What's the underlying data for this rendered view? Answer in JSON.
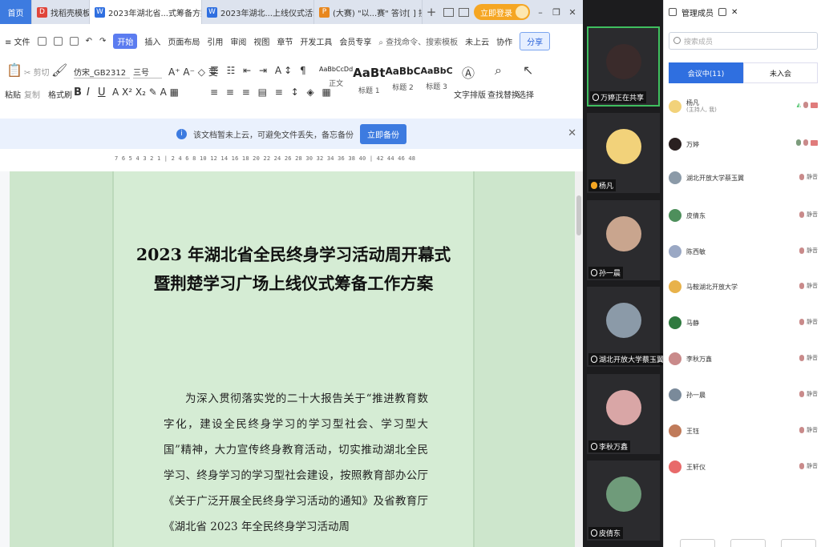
{
  "tabs": [
    {
      "label": "首页",
      "kind": "home"
    },
    {
      "label": "找稻壳模板",
      "icon_color": "#e0453a",
      "icon_char": "D"
    },
    {
      "label": "2023年湖北省...式筹备方案8.9",
      "icon_color": "#2f6fe0",
      "icon_char": "W",
      "active": true
    },
    {
      "label": "2023年湖北...上线仪式活动方案",
      "icon_color": "#2f6fe0",
      "icon_char": "W"
    },
    {
      "label": "(大赛) \"以...赛\" 答讨[ ] 接",
      "icon_color": "#e8871e",
      "icon_char": "P"
    }
  ],
  "titlebar": {
    "new_tab": "+",
    "login": "立即登录"
  },
  "menubar": {
    "file": "≡ 文件",
    "items": [
      "开始",
      "插入",
      "页面布局",
      "引用",
      "审阅",
      "视图",
      "章节",
      "开发工具",
      "会员专享"
    ],
    "search": "查找命令、搜索模板",
    "cloud": "未上云",
    "collab": "协作",
    "share": "分享"
  },
  "ribbon": {
    "paste": "粘贴",
    "cut": "剪切",
    "copy": "复制",
    "format_painter": "格式刷",
    "font_name": "仿宋_GB2312",
    "font_size": "三号",
    "styles": [
      {
        "sample": "AaBbCcDd",
        "label": "正文"
      },
      {
        "sample": "AaBt",
        "label": "标题 1"
      },
      {
        "sample": "AaBbC",
        "label": "标题 2"
      },
      {
        "sample": "AaBbC",
        "label": "标题 3"
      }
    ],
    "text_tools": "文字排版",
    "find_replace": "查找替换",
    "select": "选择"
  },
  "hint": {
    "text": "该文档暂未上云，可避免文件丢失，备忘备份",
    "button": "立即备份"
  },
  "ruler": "7 6 5 4 3 2 1 | 2 4 6 8 10 12 14 16 18 20 22 24 26 28 30 32 34 36 38 40 | 42 44 46 48",
  "document": {
    "title_line1": "2023 年湖北省全民终身学习活动周开幕式",
    "title_line2": "暨荆楚学习广场上线仪式筹备工作方案",
    "body": "为深入贯彻落实党的二十大报告关于“推进教育数字化，建设全民终身学习的学习型社会、学习型大国”精神，大力宣传终身教育活动，切实推动湖北全民学习、终身学习的学习型社会建设，按照教育部办公厅《关于广泛开展全民终身学习活动的通知》及省教育厅《湖北省 2023 年全民终身学习活动周"
  },
  "video_tiles": [
    {
      "name": "万婷正在共享",
      "face": "#3a2b2b",
      "active": true,
      "mic_on": false
    },
    {
      "name": "杨凡",
      "face": "#f2d27a",
      "active": false,
      "mic_on": true
    },
    {
      "name": "孙一晨",
      "face": "#c9a58e",
      "active": false,
      "mic_on": false
    },
    {
      "name": "湖北开放大学蔡玉翼",
      "face": "#8b9aa8",
      "active": false,
      "mic_on": false
    },
    {
      "name": "李秋万鑫",
      "face": "#d9a6a6",
      "active": false,
      "mic_on": false
    },
    {
      "name": "皮倩东",
      "face": "#6f9b7a",
      "active": false,
      "mic_on": false
    }
  ],
  "panel": {
    "title": "管理成员",
    "search_placeholder": "搜索成员",
    "tab_in": "会议中(11)",
    "tab_out": "未入会",
    "members": [
      {
        "name": "杨凡",
        "sub": "(主持人, 我)",
        "color": "#f2d27a",
        "right": ""
      },
      {
        "name": "万婷",
        "sub": "",
        "color": "#2a2020",
        "right": ""
      },
      {
        "name": "湖北开放大学蔡玉翼",
        "sub": "",
        "color": "#8b9aa8",
        "right": "静音"
      },
      {
        "name": "皮倩东",
        "sub": "",
        "color": "#4e8f5c",
        "right": "静音"
      },
      {
        "name": "陈西敏",
        "sub": "",
        "color": "#9aa8c4",
        "right": "静音"
      },
      {
        "name": "马鞍湖北开放大学",
        "sub": "",
        "color": "#e8b24a",
        "right": "静音"
      },
      {
        "name": "马静",
        "sub": "",
        "color": "#2f7a3f",
        "right": "静音"
      },
      {
        "name": "李秋万鑫",
        "sub": "",
        "color": "#c98a8a",
        "right": "静音"
      },
      {
        "name": "孙一晨",
        "sub": "",
        "color": "#7a8a9a",
        "right": "静音"
      },
      {
        "name": "王钰",
        "sub": "",
        "color": "#c07b5a",
        "right": "静音"
      },
      {
        "name": "王轩仪",
        "sub": "",
        "color": "#e86a6a",
        "right": "静音"
      }
    ]
  }
}
